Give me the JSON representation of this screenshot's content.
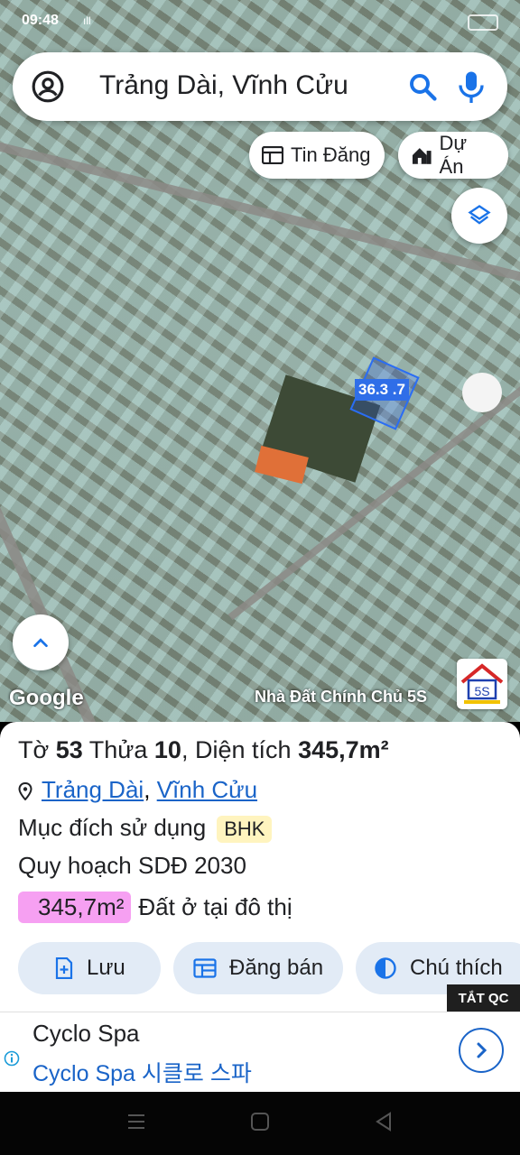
{
  "status_bar": {
    "time": "09:48",
    "signal": "ıll"
  },
  "search": {
    "query": "Trảng Dài, Vĩnh Cửu"
  },
  "chips": {
    "tin_dang": "Tin Đăng",
    "du_an": "Dự Án"
  },
  "map": {
    "parcel_label": "36.3 .7",
    "attribution": "Google",
    "watermark": "Nhà Đất Chính Chủ 5S",
    "brand_logo_text": "5S"
  },
  "parcel_info": {
    "title": {
      "to_label": "Tờ",
      "to_value": "53",
      "thua_label": "Thửa",
      "thua_value": "10",
      "area_label": "Diện tích",
      "area_value": "345,7m²"
    },
    "location": {
      "ward": "Trảng Dài",
      "sep": ",",
      "district": "Vĩnh Cửu"
    },
    "purpose": {
      "label": "Mục đích sử dụng",
      "code": "BHK"
    },
    "plan": "Quy hoạch SDĐ 2030",
    "zone": {
      "area": "345,7m²",
      "description": "Đất ở tại đô thị",
      "color": "#f6a0f2"
    }
  },
  "actions": {
    "save": "Lưu",
    "sell": "Đăng bán",
    "legend": "Chú thích"
  },
  "ad": {
    "close_label": "TẮT QC",
    "title": "Cyclo Spa",
    "subtitle": "Cyclo Spa 시클로 스파"
  },
  "colors": {
    "accent": "#1a73e8",
    "link": "#1a64c8",
    "action_bg": "#e2ebf6"
  }
}
